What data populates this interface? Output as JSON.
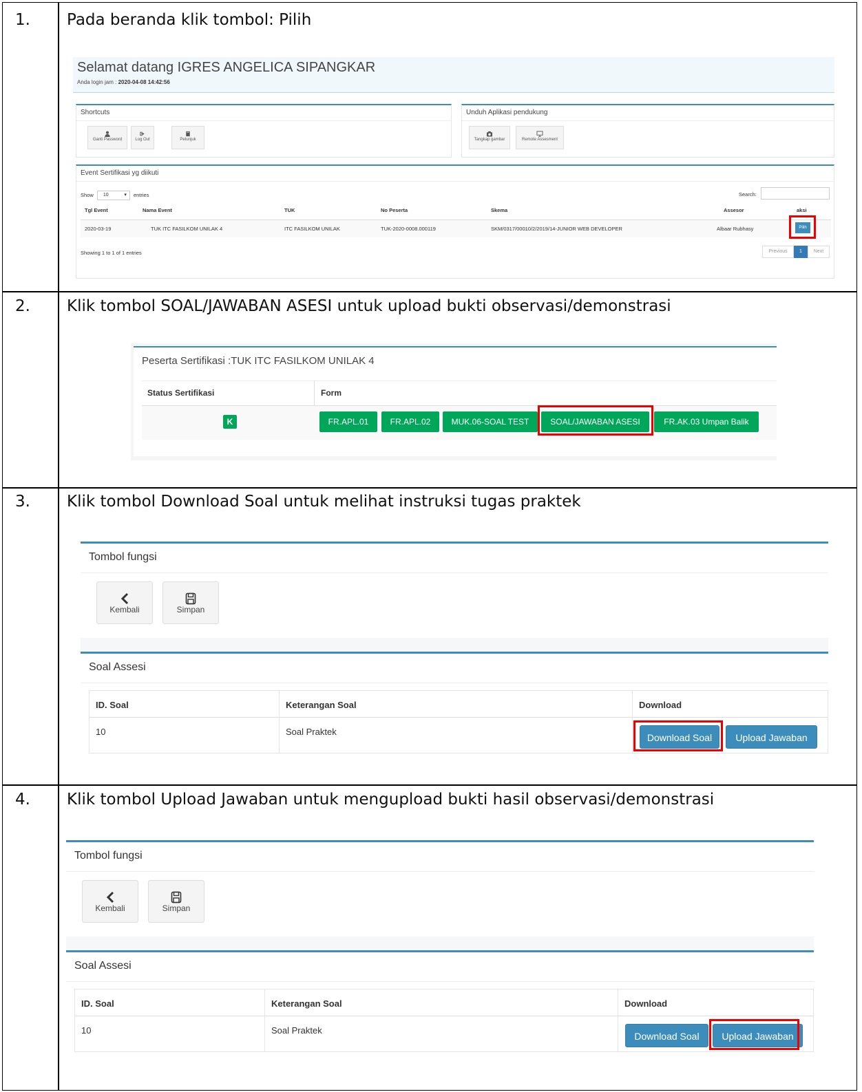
{
  "steps": [
    {
      "number": "1.",
      "text": "Pada beranda klik tombol: Pilih"
    },
    {
      "number": "2.",
      "text": "Klik tombol SOAL/JAWABAN ASESI untuk upload bukti observasi/demonstrasi"
    },
    {
      "number": "3.",
      "text": "Klik tombol Download Soal untuk melihat instruksi tugas praktek"
    },
    {
      "number": "4.",
      "text": "Klik tombol Upload Jawaban untuk mengupload bukti hasil observasi/demonstrasi"
    }
  ],
  "shot1": {
    "welcome": "Selamat datang IGRES ANGELICA SIPANGKAR",
    "login_label": "Anda login jam : ",
    "login_time": "2020-04-08 14:42:56",
    "shortcuts_title": "Shortcuts",
    "shortcuts": [
      "Ganti Password",
      "Log Out",
      "Petunjuk"
    ],
    "apps_title": "Unduh Aplikasi pendukung",
    "apps": [
      "Tangkap gambar",
      "Remote Assesment"
    ],
    "events_title": "Event Sertifikasi yg diikuti",
    "show_label": "Show",
    "show_value": "10",
    "entries_label": "entries",
    "search_label": "Search:",
    "headers": [
      "Tgl Event",
      "Nama Event",
      "TUK",
      "No Peserta",
      "Skema",
      "Assesor",
      "aksi"
    ],
    "row": [
      "2020-03-19",
      "TUK ITC FASILKOM UNILAK 4",
      "ITC FASILKOM UNILAK",
      "TUK-2020-0008.000119",
      "SKM/0317/00010/2/2019/14-JUNIOR WEB DEVELOPER",
      "Albaar Rubhasy"
    ],
    "pilih": "Pilih",
    "showing": "Showing 1 to 1 of 1 entries",
    "prev": "Previous",
    "page": "1",
    "next": "Next"
  },
  "shot2": {
    "title": "Peserta Sertifikasi :TUK ITC FASILKOM UNILAK 4",
    "col_status": "Status Sertifikasi",
    "col_form": "Form",
    "status_badge": "K",
    "buttons": [
      "FR.APL.01",
      "FR.APL.02",
      "MUK.06-SOAL TEST",
      "SOAL/JAWABAN ASESI",
      "FR.AK.03 Umpan Balik"
    ]
  },
  "shot3": {
    "tools_title": "Tombol fungsi",
    "back": "Kembali",
    "save": "Simpan",
    "soal_title": "Soal Assesi",
    "headers": [
      "ID. Soal",
      "Keterangan Soal",
      "Download"
    ],
    "row": [
      "10",
      "Soal Praktek"
    ],
    "download": "Download Soal",
    "upload": "Upload Jawaban"
  },
  "shot4": {
    "tools_title": "Tombol fungsi",
    "back": "Kembali",
    "save": "Simpan",
    "soal_title": "Soal Assesi",
    "headers": [
      "ID. Soal",
      "Keterangan Soal",
      "Download"
    ],
    "row": [
      "10",
      "Soal Praktek"
    ],
    "download": "Download Soal",
    "upload": "Upload Jawaban"
  },
  "colors": {
    "primary": "#3c8dbc",
    "success": "#00a65a",
    "highlight": "#ee0000"
  }
}
